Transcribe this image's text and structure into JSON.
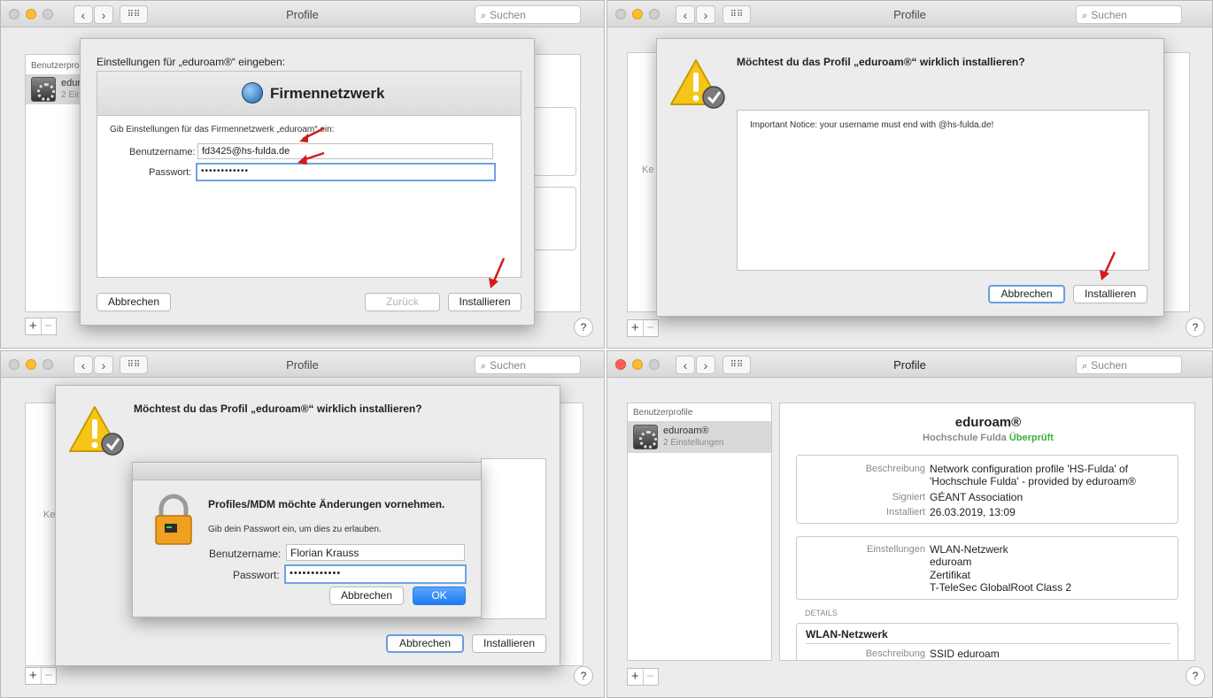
{
  "colors": {
    "red": "#ff5f57",
    "yellow": "#febc2e",
    "green": "#28c840",
    "inactive": "#d0d0d0",
    "verified": "#3cb043",
    "arrow": "#d41a1a"
  },
  "window": {
    "title": "Profile",
    "search_placeholder": "Suchen",
    "back_icon": "chevron-left-icon",
    "forward_icon": "chevron-right-icon",
    "grid_icon": "grid-icon",
    "add": "+",
    "remove": "−",
    "help": "?"
  },
  "q1": {
    "sidebar_header": "Benutzerpro",
    "profile_name": "edur",
    "profile_sub": "2 Ein",
    "dialog_title": "Einstellungen für „eduroam®“ eingeben:",
    "section_title": "Firmennetzwerk",
    "instruction": "Gib Einstellungen für das Firmennetzwerk „eduroam“ ein:",
    "username_label": "Benutzername:",
    "username_value": "fd3425@hs-fulda.de",
    "password_label": "Passwort:",
    "password_value": "••••••••••••",
    "cancel": "Abbrechen",
    "back": "Zurück",
    "install": "Installieren"
  },
  "q2": {
    "question": "Möchtest du das Profil „eduroam®“ wirklich installieren?",
    "notice": "Important Notice: your username must end with @hs-fulda.de!",
    "side_text": "Ke",
    "cancel": "Abbrechen",
    "install": "Installieren"
  },
  "q3": {
    "question": "Möchtest du das Profil „eduroam®“ wirklich installieren?",
    "side_text": "Ke",
    "auth_title": "Profiles/MDM möchte Änderungen vornehmen.",
    "auth_instruction": "Gib dein Passwort ein, um dies zu erlauben.",
    "username_label": "Benutzername:",
    "username_value": "Florian Krauss",
    "password_label": "Passwort:",
    "password_value": "••••••••••••",
    "auth_cancel": "Abbrechen",
    "auth_ok": "OK",
    "cancel": "Abbrechen",
    "install": "Installieren"
  },
  "q4": {
    "sidebar_header": "Benutzerprofile",
    "profile_name": "eduroam®",
    "profile_sub": "2 Einstellungen",
    "title": "eduroam®",
    "org": "Hochschule Fulda",
    "verified": "Überprüft",
    "desc_key": "Beschreibung",
    "desc_val_1": "Network configuration profile 'HS-Fulda' of",
    "desc_val_2": "'Hochschule Fulda' - provided by eduroam®",
    "signed_key": "Signiert",
    "signed_val": "GÉANT Association",
    "installed_key": "Installiert",
    "installed_val": "26.03.2019, 13:09",
    "settings_key": "Einstellungen",
    "setting1": "WLAN-Netzwerk",
    "setting1_sub": "eduroam",
    "setting2": "Zertifikat",
    "setting2_sub": "T-TeleSec GlobalRoot Class 2",
    "details_header": "DETAILS",
    "details_section": "WLAN-Netzwerk",
    "details_key": "Beschreibung",
    "details_val": "SSID eduroam"
  }
}
